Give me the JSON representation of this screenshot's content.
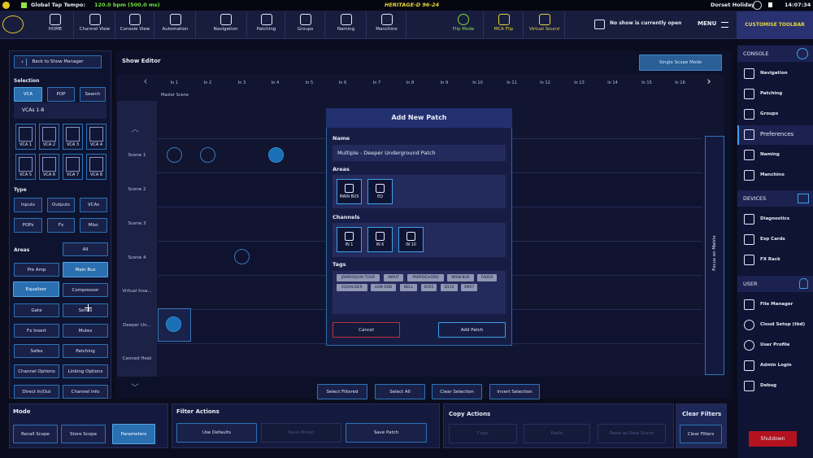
{
  "status": {
    "tap_tempo_label": "Global Tap Tempo:",
    "tap_tempo_value": "120.0 bpm (500.0 ms)",
    "console_name": "HERITAGE-D 96-24",
    "user": "Dorset Holiday",
    "time": "14:07:34"
  },
  "toolbar": {
    "items": [
      "HOME",
      "Channel View",
      "Console View",
      "Automation",
      "Navigation",
      "Patching",
      "Groups",
      "Naming",
      "Manchino",
      "Flip Mode",
      "MCA Flip",
      "Virtual Sound"
    ],
    "show_status": "No show is currently open",
    "menu": "MENU",
    "customise": "CUSTOMISE TOOLBAR"
  },
  "left": {
    "back": "Back to Show Manager",
    "selection": "Selection",
    "sel_tabs": [
      "VCA",
      "POP",
      "Search"
    ],
    "vca_group": "VCAs 1-8",
    "vcas": [
      "VCA 1",
      "VCA 2",
      "VCA 3",
      "VCA 4",
      "VCA 5",
      "VCA 6",
      "VCA 7",
      "VCA 8"
    ],
    "type": "Type",
    "types": [
      "Inputs",
      "Outputs",
      "VCAs",
      "POPs",
      "Fx",
      "Misc"
    ],
    "areas": "Areas",
    "area_all": "All",
    "area_items": [
      "Pre Amp",
      "Main Bus",
      "Equaliser",
      "Compressor",
      "Gate",
      "Sends",
      "Fx Insert",
      "Mutes",
      "Safes",
      "Patching",
      "Channel Options",
      "Linking Options",
      "Direct In/Out",
      "Channel Info"
    ]
  },
  "center": {
    "title": "Show Editor",
    "scope_mode": "Single Scope Mode",
    "columns": [
      "In 1",
      "In 2",
      "In 3",
      "In 4",
      "In 5",
      "In 6",
      "In 7",
      "In 8",
      "In 9",
      "In 10",
      "In 11",
      "In 12",
      "In 13",
      "In 14",
      "In 15",
      "In 16"
    ],
    "master_scene": "Master Scene",
    "rows": [
      "Scene 1",
      "Scene 2",
      "Scene 3",
      "Scene 4",
      "Virtual Insa...",
      "Deeper Un...",
      "Canned Heat"
    ],
    "focus": "Focus on Matrix",
    "actions": [
      "Select Filtered",
      "Select All",
      "Clear Selection",
      "Invert Selection"
    ]
  },
  "modal": {
    "title": "Add New Patch",
    "name_label": "Name",
    "name_value": "Multiple - Deeper Underground Patch",
    "areas_label": "Areas",
    "areas": [
      "MAIN BUS",
      "EQ"
    ],
    "channels_label": "Channels",
    "channels": [
      "IN 1",
      "IN 6",
      "IN 10"
    ],
    "tags_label": "Tags",
    "tags": [
      "JAMIROQUAI TOUR",
      "INPUT",
      "PARPSICHORD",
      "MAIN BUS",
      "FADER",
      "EQUALISER",
      "LOW END",
      "BELL",
      "SH55",
      "D112",
      "SM57"
    ],
    "cancel": "Cancel",
    "add": "Add Patch"
  },
  "bottom": {
    "mode": "Mode",
    "mode_buttons": [
      "Recall Scope",
      "Store Scope",
      "Parameters"
    ],
    "filter_actions": "Filter Actions",
    "filter_buttons": [
      "Use Defaults",
      "Save Preset",
      "Save Patch"
    ],
    "copy_actions": "Copy Actions",
    "copy_buttons": [
      "Copy",
      "Paste",
      "Paste as New Scene"
    ],
    "clear_filters_title": "Clear Filters",
    "clear_filters_button": "Clear Filters"
  },
  "right": {
    "console": "CONSOLE",
    "console_items": [
      "Navigation",
      "Patching",
      "Groups",
      "Preferences",
      "Naming",
      "Manchino"
    ],
    "devices": "DEVICES",
    "device_items": [
      "Diagnostics",
      "Exp Cards",
      "FX Rack"
    ],
    "user": "USER",
    "user_items": [
      "File Manager",
      "Cloud Setup (tbd)",
      "User Profile",
      "Admin Login",
      "Debug"
    ],
    "shutdown": "Shutdown"
  }
}
